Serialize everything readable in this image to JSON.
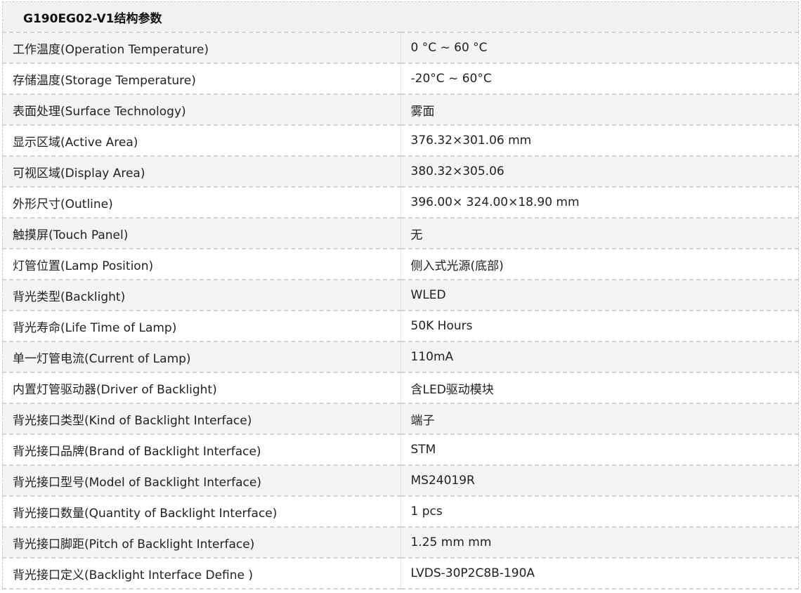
{
  "table": {
    "title": "G190EG02-V1结构参数",
    "rows": [
      {
        "label": "工作温度(Operation Temperature)",
        "value": "0 °C ~ 60 °C"
      },
      {
        "label": "存储温度(Storage Temperature)",
        "value": "-20°C ~ 60°C"
      },
      {
        "label": "表面处理(Surface Technology)",
        "value": "雾面"
      },
      {
        "label": "显示区域(Active Area)",
        "value": "376.32×301.06 mm"
      },
      {
        "label": "可视区域(Display Area)",
        "value": "380.32×305.06"
      },
      {
        "label": "外形尺寸(Outline)",
        "value": "396.00× 324.00×18.90 mm"
      },
      {
        "label": "触摸屏(Touch Panel)",
        "value": "无"
      },
      {
        "label": "灯管位置(Lamp Position)",
        "value": "侧入式光源(底部)"
      },
      {
        "label": "背光类型(Backlight)",
        "value": "WLED"
      },
      {
        "label": "背光寿命(Life Time of Lamp)",
        "value": "50K Hours"
      },
      {
        "label": "单一灯管电流(Current of Lamp)",
        "value": "110mA"
      },
      {
        "label": "内置灯管驱动器(Driver of Backlight)",
        "value": "含LED驱动模块"
      },
      {
        "label": "背光接口类型(Kind of Backlight Interface)",
        "value": "端子"
      },
      {
        "label": "背光接口品牌(Brand of Backlight Interface)",
        "value": "STM"
      },
      {
        "label": "背光接口型号(Model of Backlight Interface)",
        "value": "MS24019R"
      },
      {
        "label": "背光接口数量(Quantity of Backlight Interface)",
        "value": "1 pcs"
      },
      {
        "label": "背光接口脚距(Pitch of Backlight Interface)",
        "value": "1.25 mm mm"
      },
      {
        "label": "背光接口定义(Backlight Interface Define )",
        "value": "LVDS-30P2C8B-190A"
      }
    ]
  }
}
